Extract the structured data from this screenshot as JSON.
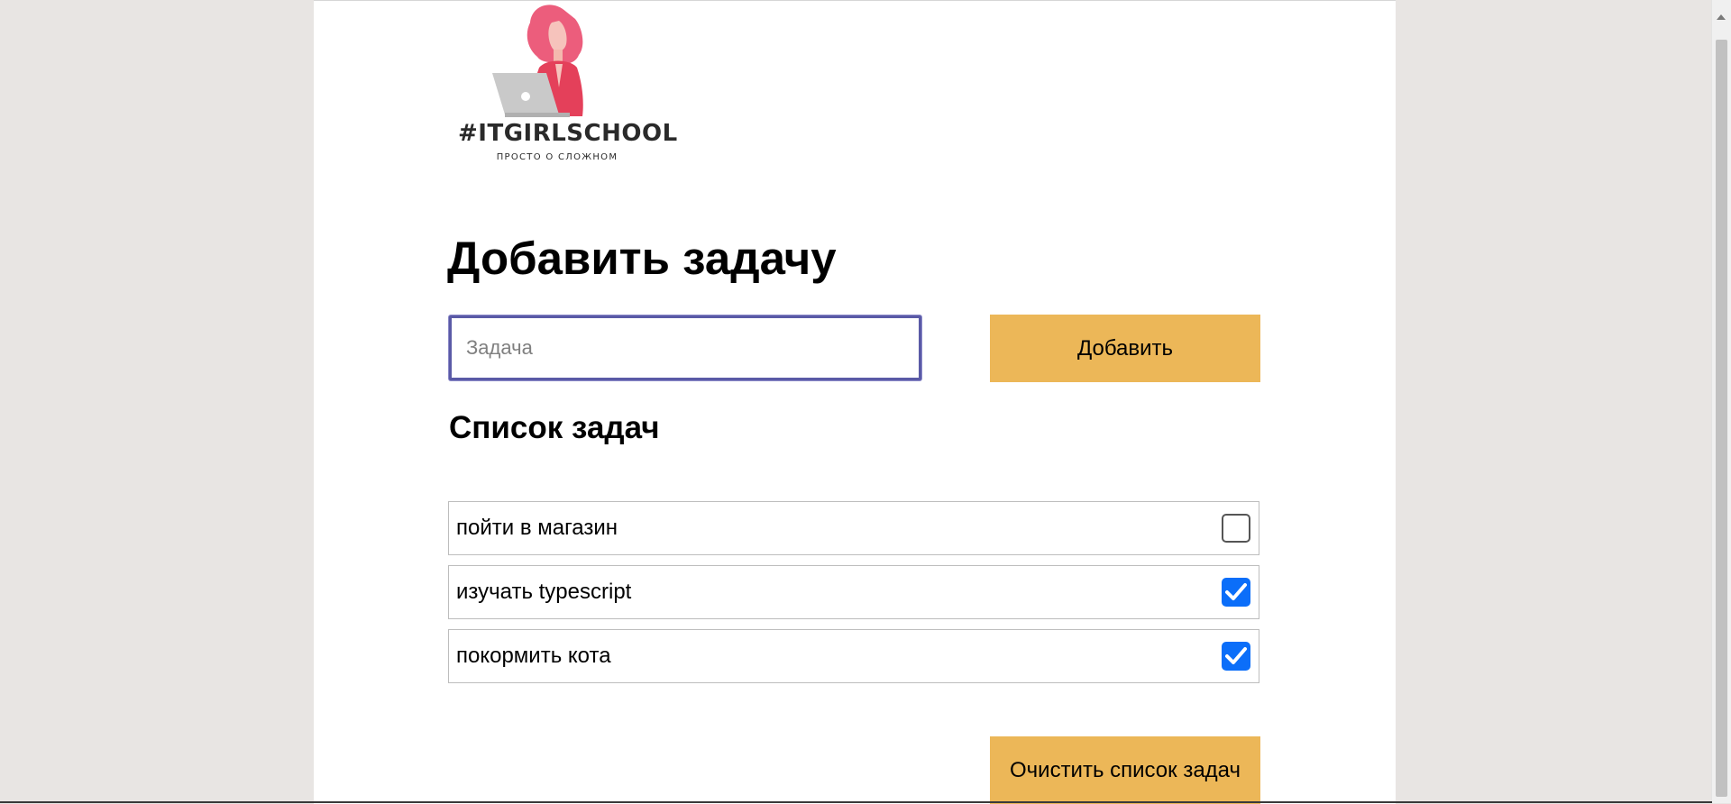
{
  "logo": {
    "text": "#ITGIRLSCHOOL",
    "subtext": "ПРОСТО О СЛОЖНОМ"
  },
  "form": {
    "title": "Добавить задачу",
    "input_placeholder": "Задача",
    "input_value": "",
    "add_button_label": "Добавить"
  },
  "list": {
    "title": "Список задач",
    "items": [
      {
        "label": "пойти в магазин",
        "checked": false
      },
      {
        "label": "изучать typescript",
        "checked": true
      },
      {
        "label": "покормить кота",
        "checked": true
      }
    ],
    "clear_button_label": "Очистить список задач"
  },
  "colors": {
    "accent_button": "#ecb758",
    "checkbox_checked": "#0b6ef9",
    "input_focus_border": "#5a5aa6",
    "page_background": "#e8e5e3"
  }
}
